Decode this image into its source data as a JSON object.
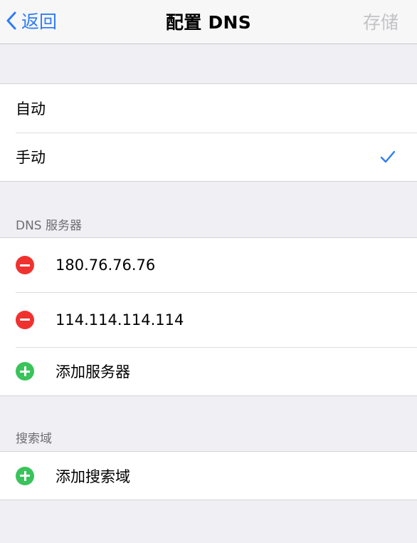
{
  "navbar": {
    "back_label": "返回",
    "title": "配置 DNS",
    "save_label": "存储"
  },
  "mode": {
    "options": [
      {
        "label": "自动",
        "selected": false
      },
      {
        "label": "手动",
        "selected": true
      }
    ]
  },
  "dns_servers": {
    "header": "DNS 服务器",
    "servers": [
      "180.76.76.76",
      "114.114.114.114"
    ],
    "add_label": "添加服务器"
  },
  "search_domains": {
    "header": "搜索域",
    "add_label": "添加搜索域"
  },
  "colors": {
    "accent": "#2f7cf6",
    "delete": "#f0322f",
    "add": "#3ac35b",
    "disabled": "#c3c3c6"
  }
}
